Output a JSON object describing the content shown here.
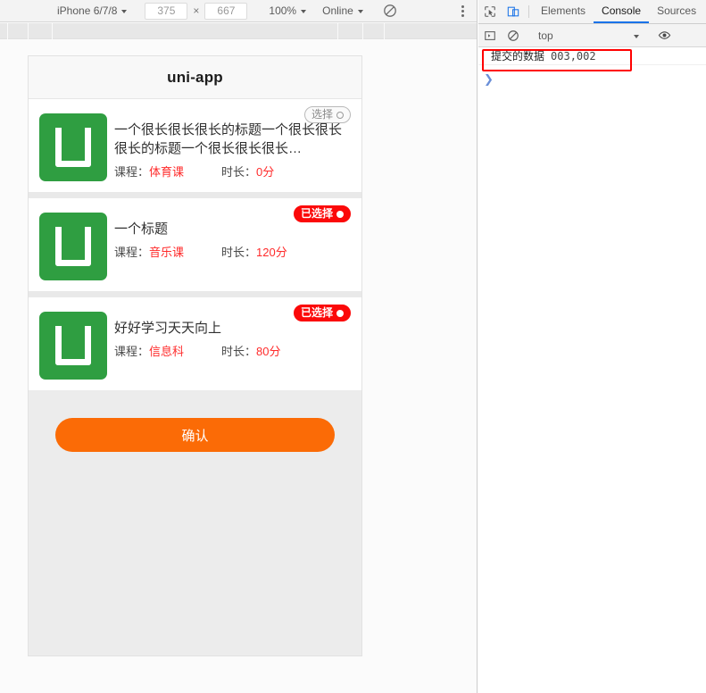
{
  "device_toolbar": {
    "device_name": "iPhone 6/7/8",
    "width": "375",
    "height": "667",
    "x_label": "×",
    "zoom": "100%",
    "throttling": "Online",
    "rotate_icon": "rotate-icon",
    "menu_icon": "more-vertical-icon"
  },
  "viewport": {
    "header_title": "uni-app",
    "cards": [
      {
        "title": "一个很长很长很长的标题一个很长很长很长的标题一个很长很长很长…",
        "course_label": "课程：",
        "course_value": "体育课",
        "duration_label": "时长：",
        "duration_value": "0分",
        "badge_label": "选择",
        "selected": false,
        "logo_icon": "uni-app-logo-icon"
      },
      {
        "title": "一个标题",
        "course_label": "课程：",
        "course_value": "音乐课",
        "duration_label": "时长：",
        "duration_value": "120分",
        "badge_label": "已选择",
        "selected": true,
        "logo_icon": "uni-app-logo-icon"
      },
      {
        "title": "好好学习天天向上",
        "course_label": "课程：",
        "course_value": "信息科",
        "duration_label": "时长：",
        "duration_value": "80分",
        "badge_label": "已选择",
        "selected": true,
        "logo_icon": "uni-app-logo-icon"
      }
    ],
    "confirm_label": "确认"
  },
  "devtools": {
    "inspect_icon": "inspect-element-icon",
    "device_toggle_icon": "toggle-device-toolbar-icon",
    "tabs": [
      {
        "label": "Elements",
        "active": false
      },
      {
        "label": "Console",
        "active": true
      },
      {
        "label": "Sources",
        "active": false
      }
    ],
    "console_toolbar": {
      "sidebar_icon": "console-sidebar-icon",
      "clear_icon": "clear-console-icon",
      "context": "top",
      "eye_icon": "live-expression-eye-icon"
    },
    "console_messages": [
      {
        "text": "提交的数据",
        "value": "003,002"
      }
    ],
    "prompt_symbol": "❯"
  },
  "colors": {
    "brand_green": "#2f9e41",
    "accent_orange": "#fb6b06",
    "selected_red": "#fb0909",
    "hot_text_red": "#ff2b2b",
    "annotation_red": "#ff0000",
    "devtools_active_blue": "#1a73e8"
  }
}
